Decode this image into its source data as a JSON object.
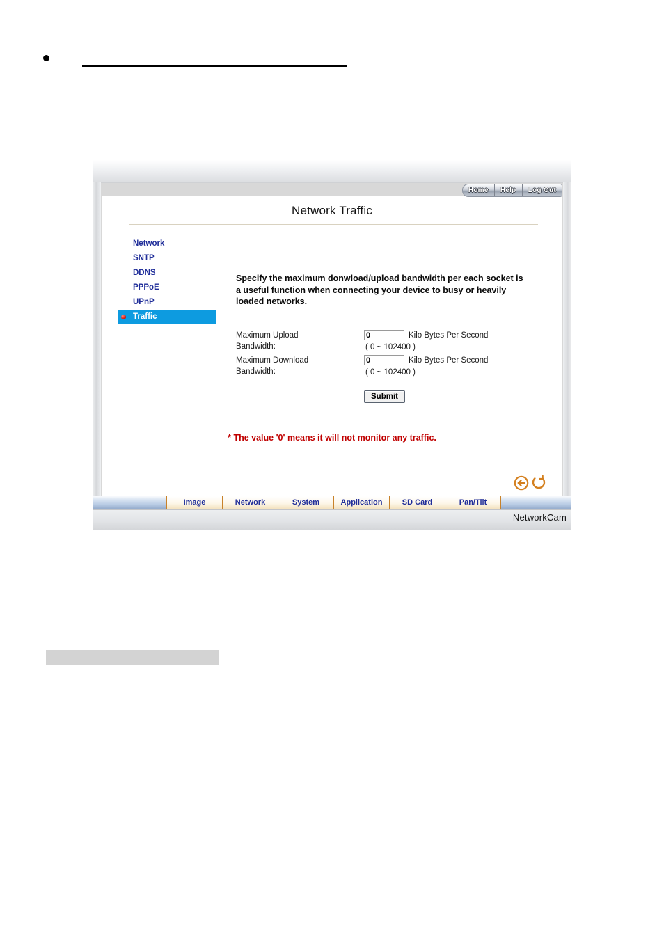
{
  "document": {
    "heading_bullet": "●",
    "heading_text": "",
    "grey_block_text": ""
  },
  "window": {
    "brand": "NetworkCam"
  },
  "topnav": {
    "items": [
      {
        "label": "Home",
        "name": "home"
      },
      {
        "label": "Help",
        "name": "help"
      },
      {
        "label": "Log Out",
        "name": "log-out"
      }
    ]
  },
  "page": {
    "title": "Network Traffic",
    "description": "Specify the maximum donwload/upload bandwidth per each socket is a useful function when connecting your device to busy or heavily loaded networks.",
    "note": "* The value '0' means it will not monitor any traffic."
  },
  "sidebar": {
    "items": [
      {
        "label": "Network",
        "active": false
      },
      {
        "label": "SNTP",
        "active": false
      },
      {
        "label": "DDNS",
        "active": false
      },
      {
        "label": "PPPoE",
        "active": false
      },
      {
        "label": "UPnP",
        "active": false
      },
      {
        "label": "Traffic",
        "active": true
      }
    ],
    "active_color": "#0d9be0",
    "link_color": "#1f2d99",
    "bullet_color": "#e01b12"
  },
  "form": {
    "upload": {
      "label_line1": "Maximum Upload",
      "label_line2": "Bandwidth:",
      "value": "0",
      "unit": "Kilo Bytes Per Second",
      "range": "( 0 ~ 102400 )"
    },
    "download": {
      "label_line1": "Maximum Download",
      "label_line2": "Bandwidth:",
      "value": "0",
      "unit": "Kilo Bytes Per Second",
      "range": "( 0 ~ 102400 )"
    },
    "submit_label": "Submit"
  },
  "icons": {
    "back": "back-arrow-icon",
    "refresh": "refresh-icon",
    "accent_color": "#d4801f"
  },
  "tabs": {
    "items": [
      {
        "label": "Image"
      },
      {
        "label": "Network"
      },
      {
        "label": "System"
      },
      {
        "label": "Application"
      },
      {
        "label": "SD Card"
      },
      {
        "label": "Pan/Tilt"
      }
    ],
    "border_color": "#c8822a",
    "text_color": "#1f2d99"
  }
}
